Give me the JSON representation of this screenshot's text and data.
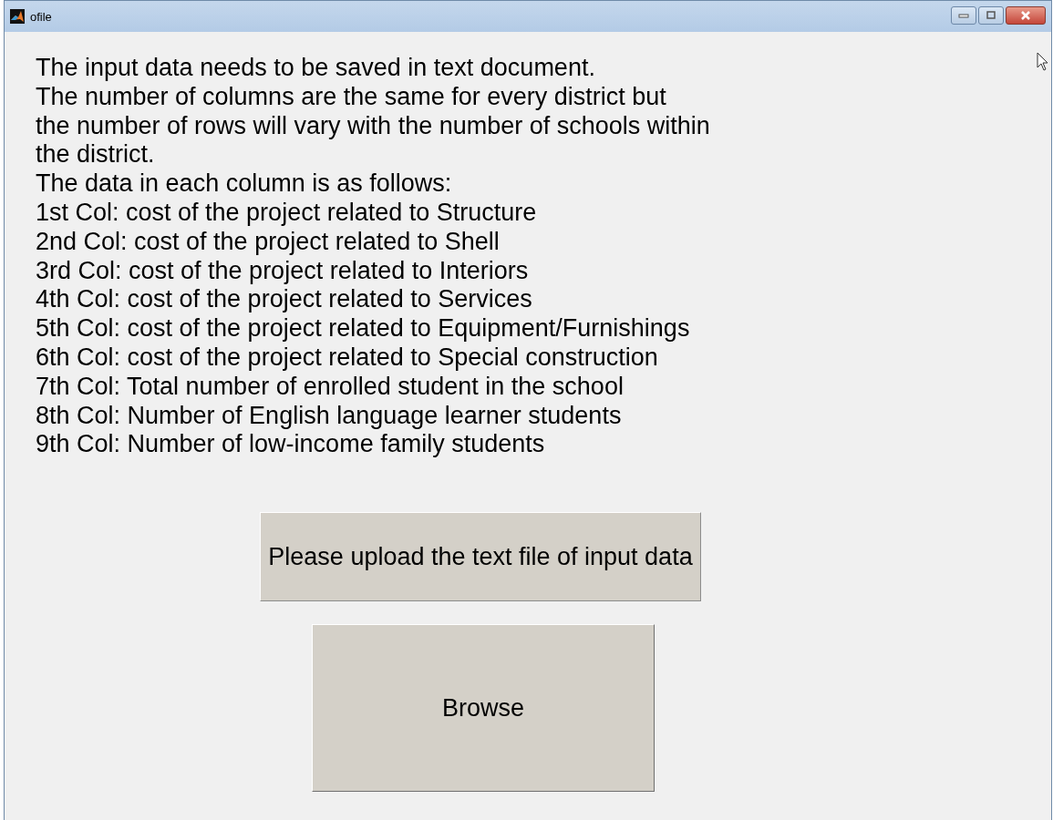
{
  "window": {
    "title": "ofile"
  },
  "instructions": [
    "The input data needs to be saved in text document.",
    "The number of columns are the same for every district but",
    "the number of rows will vary with the number of schools within",
    "the district.",
    "The data in each column is as follows:",
    "1st Col: cost of the project related to Structure",
    "2nd Col: cost of the project related to Shell",
    "3rd Col: cost of the project related to Interiors",
    "4th Col: cost of the project related to Services",
    "5th Col: cost of the project related to Equipment/Furnishings",
    "6th Col: cost of the project related to Special construction",
    "7th Col: Total number of enrolled student in the school",
    "8th Col: Number of English language learner students",
    "9th Col: Number of low-income family students"
  ],
  "upload_prompt": "Please upload the text file of input data",
  "browse_button": "Browse"
}
